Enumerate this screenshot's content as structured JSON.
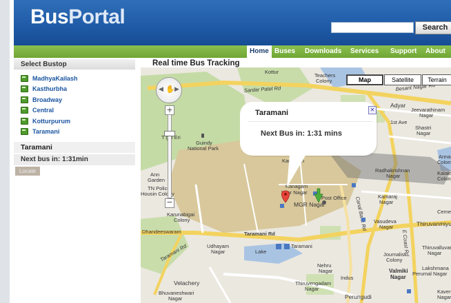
{
  "header": {
    "logo_part1": "Bus",
    "logo_part2": "Portal",
    "search_button": "Search",
    "search_value": ""
  },
  "nav": [
    "Home",
    "Buses",
    "Downloads",
    "Services",
    "Support",
    "About"
  ],
  "sidebar": {
    "title": "Select Bustop",
    "stops": [
      "MadhyaKailash",
      "Kasthurbha",
      "Broadway",
      "Central",
      "Kotturpurum",
      "Taramani"
    ],
    "selected_stop": "Taramani",
    "next_bus": "Next bus in: 1:31min",
    "locate_button": "Locate"
  },
  "map": {
    "title": "Real time Bus Tracking",
    "map_types": [
      "Map",
      "Satellite",
      "Terrain"
    ],
    "active_map_type": "Map",
    "popup": {
      "title": "Taramani",
      "text": "Next Bus in: 1:31 mins"
    },
    "labels": {
      "kottur": "Kottur",
      "teachers_colony_1": "Teachers",
      "teachers_colony_2": "Colony",
      "sardar_patel_rd": "Sardar Patel Rd",
      "besant_nagar_rd": "Besant Nagar Rd",
      "adyar": "Adyar",
      "jeevarathinam_1": "Jeevarathinam",
      "jeevarathinam_2": "Nagar",
      "first_ave": "1st Ave",
      "shastri_1": "Shastri",
      "shastri_2": "Nagar",
      "guindy_1": "Guindy",
      "guindy_2": "National Park",
      "tugal_eri": "T  gal Eri",
      "kanagam": "Kanagam",
      "radhakrishnan_1": "Radhakrishnan",
      "radhakrishnan_2": "Nagar",
      "anna_1": "Anna",
      "anna_2": "Colony",
      "kalaksh": "Kalaksh",
      "kalaksh_2": "Colony",
      "anna_garden_1": "Ann",
      "anna_garden_2": "Garden",
      "tn_police_1": "TN Police",
      "tn_police_2": "Housin  Colony",
      "kanagam_2": "Kanagam",
      "vyar_nagar": "Vyar Nagar",
      "post_office": "Post Office",
      "mgr_nagar": "MGR Nagar",
      "kamaraj_1": "Kamaraj",
      "kamaraj_2": "Nagar",
      "canal_bank_rd": "Canal Bank Rd",
      "cemetery": "Cemete",
      "karunabigai_1": "Karunabigai",
      "karunabigai_2": "Colony",
      "vasudeva_1": "Vasudeva",
      "vasudeva_2": "Nagar",
      "thiruvanmiyur": "Thiruvanmiyur",
      "dhandeeswaram": "Dhandeeswaram",
      "taramani_rd": "Taramani Rd",
      "e_coast_rd": "E Coast Rd",
      "taramani_rd_2": "Taramani Rd",
      "udhayam_1": "Udhayam",
      "udhayam_2": "Nagar",
      "lake": "Lake",
      "taramani": "Taramani",
      "thiruvalluvar_1": "Thiruvalluvar",
      "thiruvalluvar_2": "Nagar",
      "journalist_1": "Journalist",
      "journalist_2": "Colony",
      "valmiki_1": "Valmiki",
      "valmiki_2": "Nagar",
      "lakshmana_1": "Lakshmana",
      "lakshmana_2": "Perumal Nagar",
      "nehru_1": "Nehru",
      "nehru_2": "Nagar",
      "indus": "Indus",
      "velachery": "Velachery",
      "thiruvengadam_1": "Thiruvengadam",
      "thiruvengadam_2": "Nagar",
      "bhuvaneshwari_1": "Bhuvaneshwari",
      "bhuvaneshwari_2": "Nagar",
      "perungudi": "Perungudi",
      "kaveri_1": "Kaven",
      "kaveri_2": "Nagar"
    }
  },
  "colors": {
    "header_blue": "#1f5aa6",
    "nav_green": "#7ab23f",
    "stop_link": "#1b55a0",
    "park_green": "#c6dca8",
    "campus_tan": "#d9c9a0",
    "water_blue": "#a9c4e3"
  }
}
